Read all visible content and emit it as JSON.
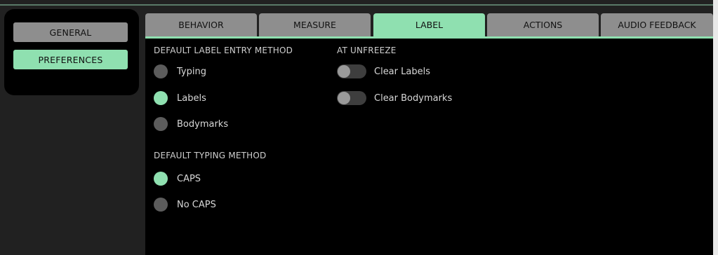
{
  "nav": {
    "items": [
      {
        "label": "GENERAL",
        "active": false
      },
      {
        "label": "PREFERENCES",
        "active": true
      }
    ]
  },
  "tabs": [
    {
      "label": "BEHAVIOR",
      "active": false
    },
    {
      "label": "MEASURE",
      "active": false
    },
    {
      "label": "LABEL",
      "active": true
    },
    {
      "label": "ACTIONS",
      "active": false
    },
    {
      "label": "AUDIO FEEDBACK",
      "active": false
    }
  ],
  "label_entry": {
    "heading": "DEFAULT LABEL ENTRY METHOD",
    "options": [
      {
        "label": "Typing",
        "selected": false
      },
      {
        "label": "Labels",
        "selected": true
      },
      {
        "label": "Bodymarks",
        "selected": false
      }
    ]
  },
  "typing_method": {
    "heading": "DEFAULT TYPING METHOD",
    "options": [
      {
        "label": "CAPS",
        "selected": true
      },
      {
        "label": "No CAPS",
        "selected": false
      }
    ]
  },
  "unfreeze": {
    "heading": "AT UNFREEZE",
    "toggles": [
      {
        "label": "Clear Labels",
        "on": false
      },
      {
        "label": "Clear Bodymarks",
        "on": false
      }
    ]
  },
  "colors": {
    "accent": "#8fe0b0",
    "inactive": "#8e8e8e",
    "panel": "#000000",
    "background": "#212121"
  },
  "icons": {
    "radio": "radio-button-icon",
    "toggle": "toggle-switch-icon"
  }
}
